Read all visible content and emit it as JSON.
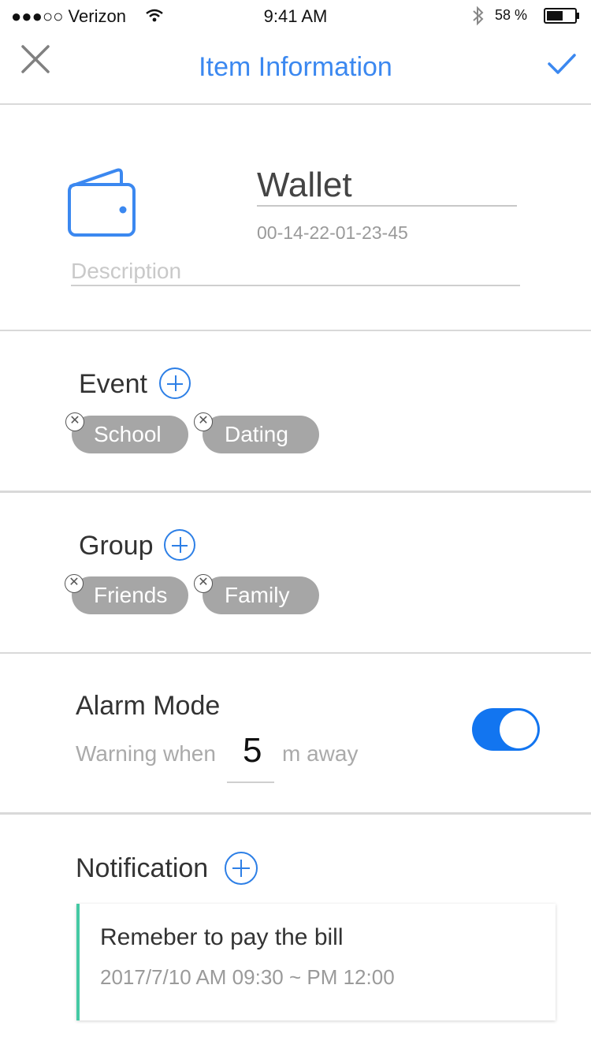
{
  "status_bar": {
    "carrier": "●●●○○ Verizon",
    "time": "9:41 AM",
    "battery_percent": "58 %",
    "battery_level": 0.58
  },
  "nav": {
    "title": "Item Information",
    "close_icon": "close-icon",
    "confirm_icon": "checkmark-icon",
    "accent_color": "#3b88f0"
  },
  "item": {
    "icon": "wallet-icon",
    "name": "Wallet",
    "mac": "00-14-22-01-23-45",
    "description_placeholder": "Description"
  },
  "event": {
    "title": "Event",
    "tags": [
      "School",
      "Dating"
    ]
  },
  "group": {
    "title": "Group",
    "tags": [
      "Friends",
      "Family"
    ]
  },
  "alarm": {
    "title": "Alarm Mode",
    "warning_prefix": "Warning when",
    "distance": "5",
    "warning_suffix": "m away",
    "enabled": true,
    "toggle_color": "#1275f0"
  },
  "notification": {
    "title": "Notification",
    "items": [
      {
        "text": "Remeber to pay the bill",
        "time": "2017/7/10 AM 09:30 ~ PM 12:00",
        "accent_color": "#45c9a4"
      }
    ]
  }
}
